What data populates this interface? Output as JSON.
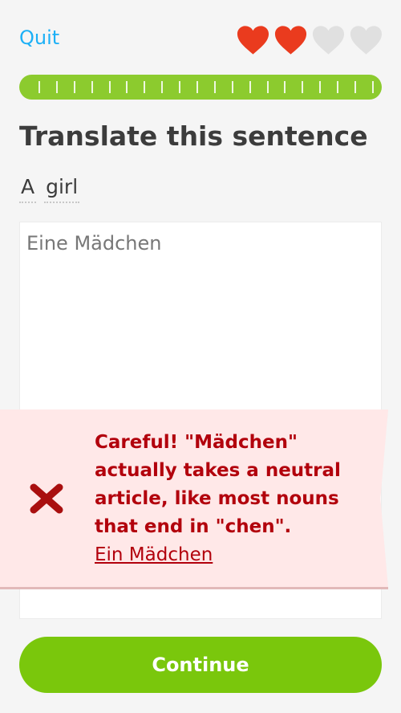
{
  "header": {
    "quit_label": "Quit",
    "hearts": [
      "filled",
      "filled",
      "empty",
      "empty"
    ],
    "colors": {
      "heart_filled": "#ea3b1e",
      "heart_empty": "#e0e0e0",
      "link": "#1cb0f6"
    }
  },
  "progress": {
    "fraction": 1.0,
    "color": "#8ccb2e"
  },
  "exercise": {
    "title": "Translate this sentence",
    "prompt_words": [
      "A",
      "girl"
    ],
    "answer_text": "Eine Mädchen"
  },
  "feedback": {
    "icon": "x-icon",
    "message": "Careful! \"Mädchen\" actually takes a neutral article, like most nouns that end in \"chen\".",
    "correction_link": "Ein Mädchen",
    "colors": {
      "background": "#ffe8e8",
      "text": "#b2000c"
    }
  },
  "footer": {
    "continue_label": "Continue",
    "color": "#7ac70c"
  }
}
